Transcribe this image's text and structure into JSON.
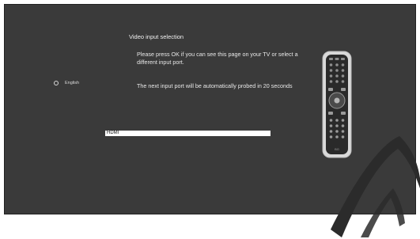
{
  "screen": {
    "title": "Video input selection",
    "message_1": "Please press OK if you can see this page on your TV or select a different input port.",
    "message_2": "The next input port will be automatically probed in 20 seconds"
  },
  "language": {
    "label": "English"
  },
  "input": {
    "value": "HDMI"
  },
  "remote": {
    "brand": "BG",
    "icon": "remote-control-icon"
  },
  "colors": {
    "background": "#3a3a3a",
    "text": "#e6e6e6",
    "field": "#ffffff"
  }
}
